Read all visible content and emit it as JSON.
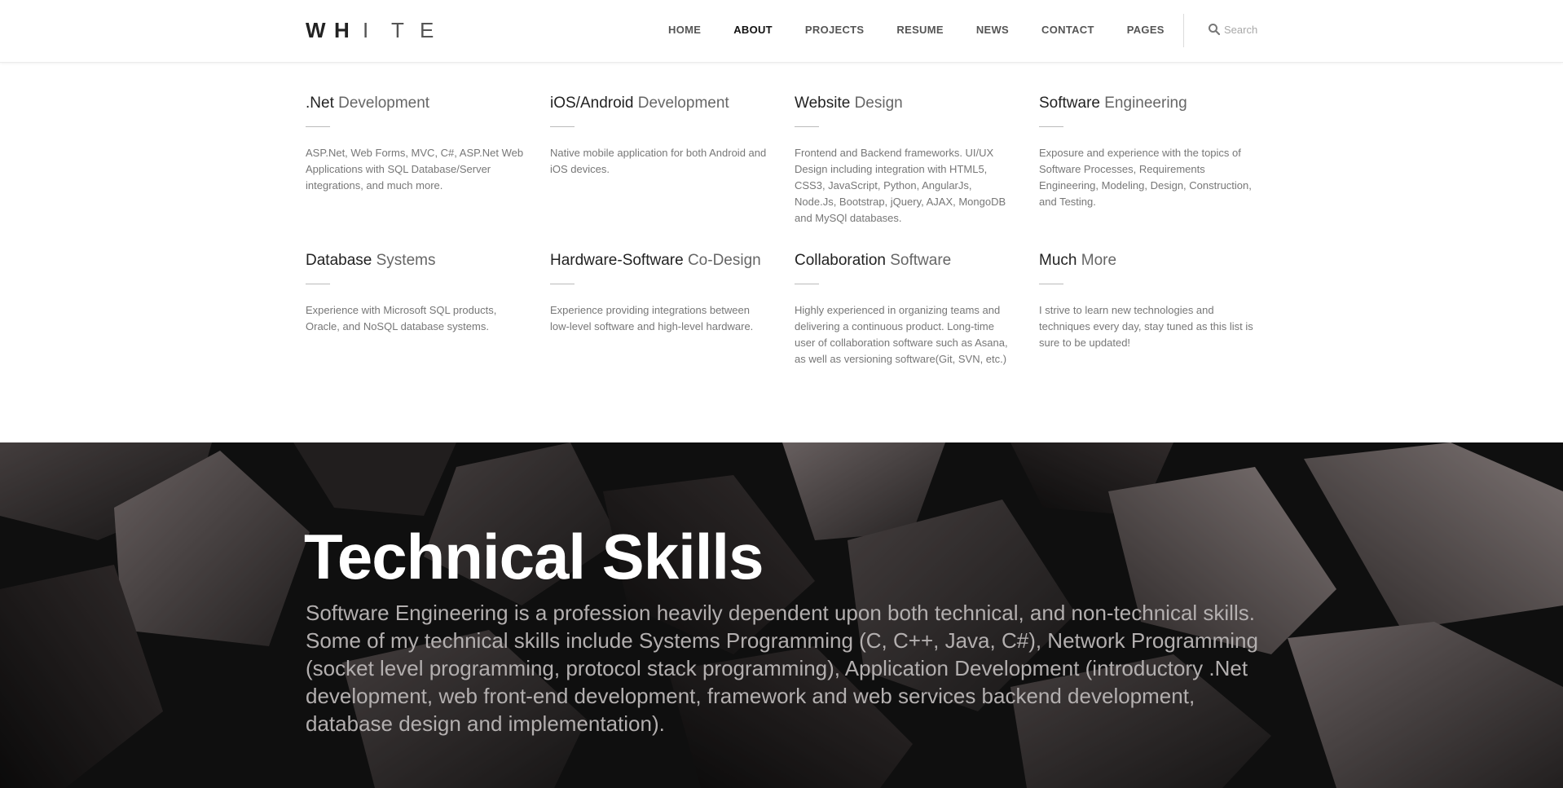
{
  "header": {
    "logo_letters": [
      "W",
      "H",
      "I",
      "T",
      "E"
    ],
    "nav": [
      {
        "label": "HOME",
        "active": false
      },
      {
        "label": "ABOUT",
        "active": true
      },
      {
        "label": "PROJECTS",
        "active": false
      },
      {
        "label": "RESUME",
        "active": false
      },
      {
        "label": "NEWS",
        "active": false
      },
      {
        "label": "CONTACT",
        "active": false
      },
      {
        "label": "PAGES",
        "active": false
      }
    ],
    "search": {
      "placeholder": "Search",
      "icon": "search-icon"
    }
  },
  "services": [
    {
      "strong": ".Net",
      "rest": " Development",
      "desc": "ASP.Net, Web Forms, MVC, C#, ASP.Net Web Applications with SQL Database/Server integrations, and much more."
    },
    {
      "strong": "iOS/Android",
      "rest": " Development",
      "desc": "Native mobile application for both Android and iOS devices."
    },
    {
      "strong": "Website",
      "rest": " Design",
      "desc": "Frontend and Backend frameworks. UI/UX Design including integration with HTML5, CSS3, JavaScript, Python, AngularJs, Node.Js, Bootstrap, jQuery, AJAX, MongoDB and MySQl databases."
    },
    {
      "strong": "Software",
      "rest": " Engineering",
      "desc": "Exposure and experience with the topics of Software Processes, Requirements Engineering, Modeling, Design, Construction, and Testing."
    },
    {
      "strong": "Database",
      "rest": " Systems",
      "desc": "Experience with Microsoft SQL products, Oracle, and NoSQL database systems."
    },
    {
      "strong": "Hardware-Software",
      "rest": " Co-Design",
      "desc": "Experience providing integrations between low-level software and high-level hardware."
    },
    {
      "strong": "Collaboration",
      "rest": " Software",
      "desc": "Highly experienced in organizing teams and delivering a continuous product. Long-time user of collaboration software such as Asana, as well as versioning software(Git, SVN, etc.)"
    },
    {
      "strong": "Much",
      "rest": " More",
      "desc": "I strive to learn new technologies and techniques every day, stay tuned as this list is sure to be updated!"
    }
  ],
  "hero": {
    "title": "Technical Skills",
    "text": "Software Engineering is a profession heavily dependent upon both technical, and non-technical skills. Some of my technical skills include Systems Programming (C, C++, Java, C#), Network Programming (socket level programming, protocol stack programming), Application Development (introductory .Net development, web front-end development, framework and web services backend development, database design and implementation)."
  },
  "colors": {
    "hero_bg": "#151414",
    "hero_text": "#b3afaf",
    "nav_active": "#111111"
  }
}
